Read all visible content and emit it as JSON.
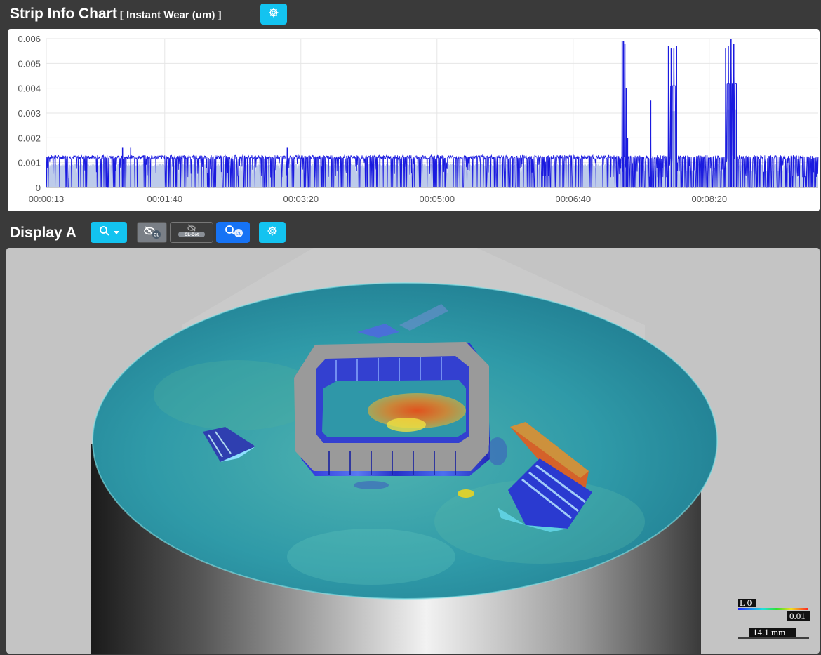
{
  "chart_header": {
    "title": "Strip Info Chart",
    "subtitle": "[ Instant Wear (um) ]"
  },
  "display_header": {
    "title": "Display A"
  },
  "toolbar": {
    "zoom_label": "Q",
    "badge_cl": "CL",
    "badge_cl_dot": "CL-Dot",
    "badge_cl2": "CL",
    "colors": {
      "cyan": "#13c3f0",
      "blue": "#1673f5",
      "grey": "#7a7f86"
    }
  },
  "chart_data": {
    "type": "line",
    "title": "Strip Info Chart",
    "subtitle": "[ Instant Wear (um) ]",
    "ylim": [
      0,
      0.006
    ],
    "yticks": [
      "0.006",
      "0.005",
      "0.004",
      "0.003",
      "0.002",
      "0.001",
      "0"
    ],
    "xtick_labels": [
      "00:00:13",
      "00:01:40",
      "00:03:20",
      "00:05:00",
      "00:06:40",
      "00:08:20"
    ],
    "xrange_seconds": [
      13,
      580
    ],
    "grid": true,
    "series_color": "#1a1adf",
    "fill_color": "#b6c5e8",
    "baseline_level": 0.0013,
    "spikes": [
      {
        "t": 69,
        "y": 0.0016
      },
      {
        "t": 75,
        "y": 0.0016
      },
      {
        "t": 190,
        "y": 0.0016
      },
      {
        "t": 436,
        "y": 0.0059
      },
      {
        "t": 437,
        "y": 0.0059
      },
      {
        "t": 438,
        "y": 0.0058
      },
      {
        "t": 439,
        "y": 0.004
      },
      {
        "t": 440,
        "y": 0.002
      },
      {
        "t": 457,
        "y": 0.0035
      },
      {
        "t": 470,
        "y": 0.0057
      },
      {
        "t": 472,
        "y": 0.0056
      },
      {
        "t": 474,
        "y": 0.0056
      },
      {
        "t": 476,
        "y": 0.0057
      },
      {
        "t": 512,
        "y": 0.0056
      },
      {
        "t": 514,
        "y": 0.0057
      },
      {
        "t": 516,
        "y": 0.006
      },
      {
        "t": 518,
        "y": 0.0058
      },
      {
        "t": 520,
        "y": 0.0042
      }
    ],
    "plateaus": [
      {
        "from": 470,
        "to": 476,
        "y": 0.0041
      },
      {
        "from": 512,
        "to": 520,
        "y": 0.0042
      }
    ]
  },
  "color_legend": {
    "min_label": "L 0",
    "max_label": "0.01",
    "scale_label": "14.1 mm"
  }
}
